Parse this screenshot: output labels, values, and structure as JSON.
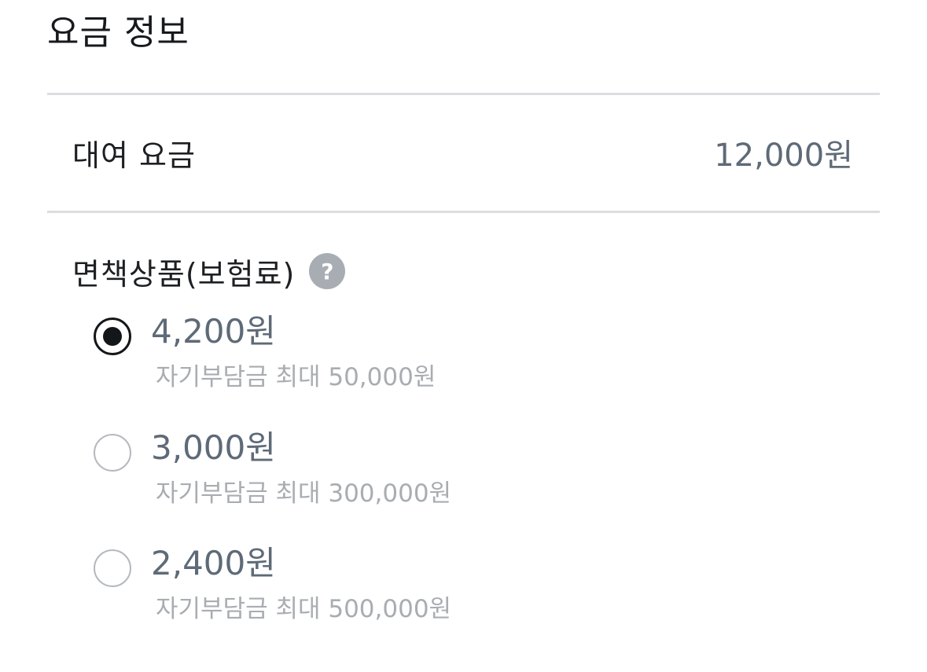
{
  "header": {
    "title": "요금 정보"
  },
  "rental": {
    "label": "대여 요금",
    "value": "12,000원"
  },
  "insurance": {
    "label": "면책상품(보험료)",
    "help_icon": "?",
    "selected_index": 0,
    "options": [
      {
        "price": "4,200원",
        "description": "자기부담금 최대 50,000원"
      },
      {
        "price": "3,000원",
        "description": "자기부담금 최대 300,000원"
      },
      {
        "price": "2,400원",
        "description": "자기부담금 최대 500,000원"
      }
    ]
  }
}
